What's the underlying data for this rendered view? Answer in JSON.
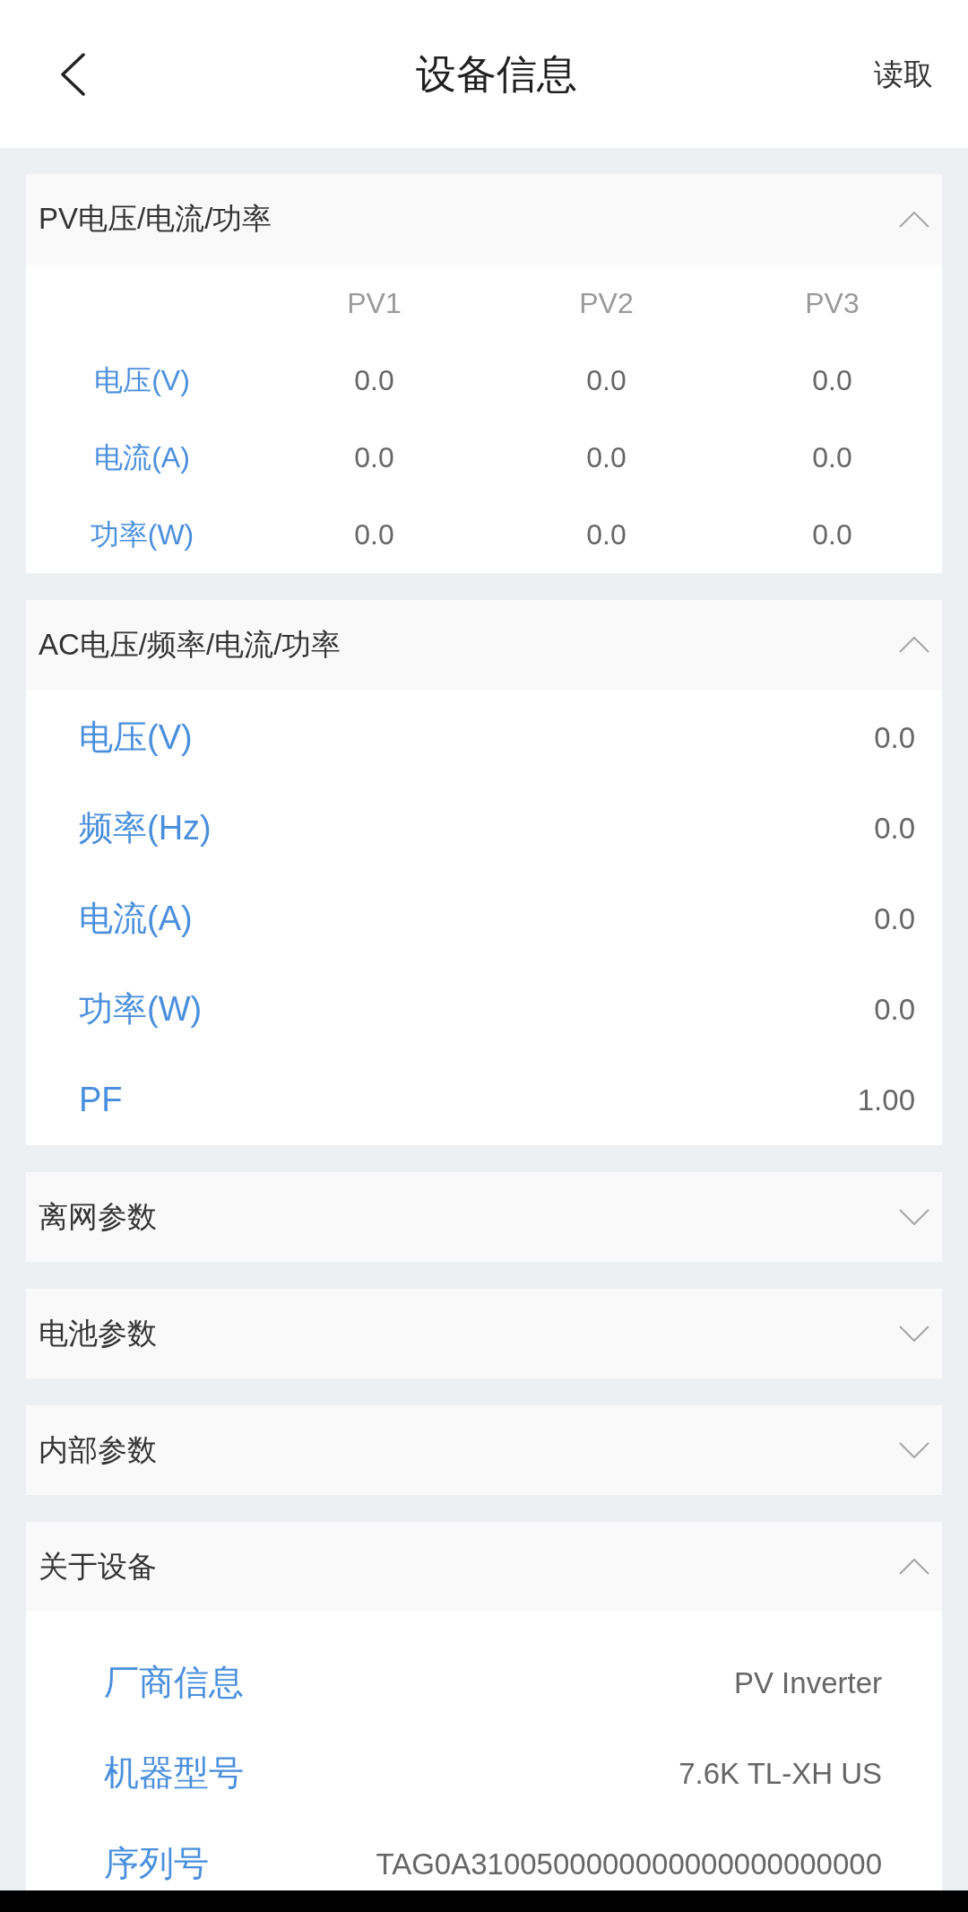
{
  "top_bar": {
    "title": "设备信息",
    "action": "读取"
  },
  "sections": [
    {
      "kind": "table",
      "title": "PV电压/电流/功率",
      "expanded": true,
      "columns": [
        "PV1",
        "PV2",
        "PV3"
      ],
      "rows": [
        {
          "label": "电压(V)",
          "values": [
            "0.0",
            "0.0",
            "0.0"
          ]
        },
        {
          "label": "电流(A)",
          "values": [
            "0.0",
            "0.0",
            "0.0"
          ]
        },
        {
          "label": "功率(W)",
          "values": [
            "0.0",
            "0.0",
            "0.0"
          ]
        }
      ]
    },
    {
      "kind": "readings",
      "title": "AC电压/频率/电流/功率",
      "expanded": true,
      "rows": [
        {
          "label": "电压(V)",
          "value": "0.0"
        },
        {
          "label": "频率(Hz)",
          "value": "0.0"
        },
        {
          "label": "电流(A)",
          "value": "0.0"
        },
        {
          "label": "功率(W)",
          "value": "0.0"
        },
        {
          "label": "PF",
          "value": "1.00"
        }
      ]
    },
    {
      "title": "离网参数",
      "expanded": false
    },
    {
      "title": "电池参数",
      "expanded": false
    },
    {
      "title": "内部参数",
      "expanded": false
    },
    {
      "kind": "details",
      "title": "关于设备",
      "expanded": true,
      "rows": [
        {
          "label": "厂商信息",
          "value": "PV Inverter"
        },
        {
          "label": "机器型号",
          "value": "7.6K TL-XH US"
        },
        {
          "label": "序列号",
          "value": "TAG0A3100500000000000000000000"
        }
      ]
    }
  ]
}
